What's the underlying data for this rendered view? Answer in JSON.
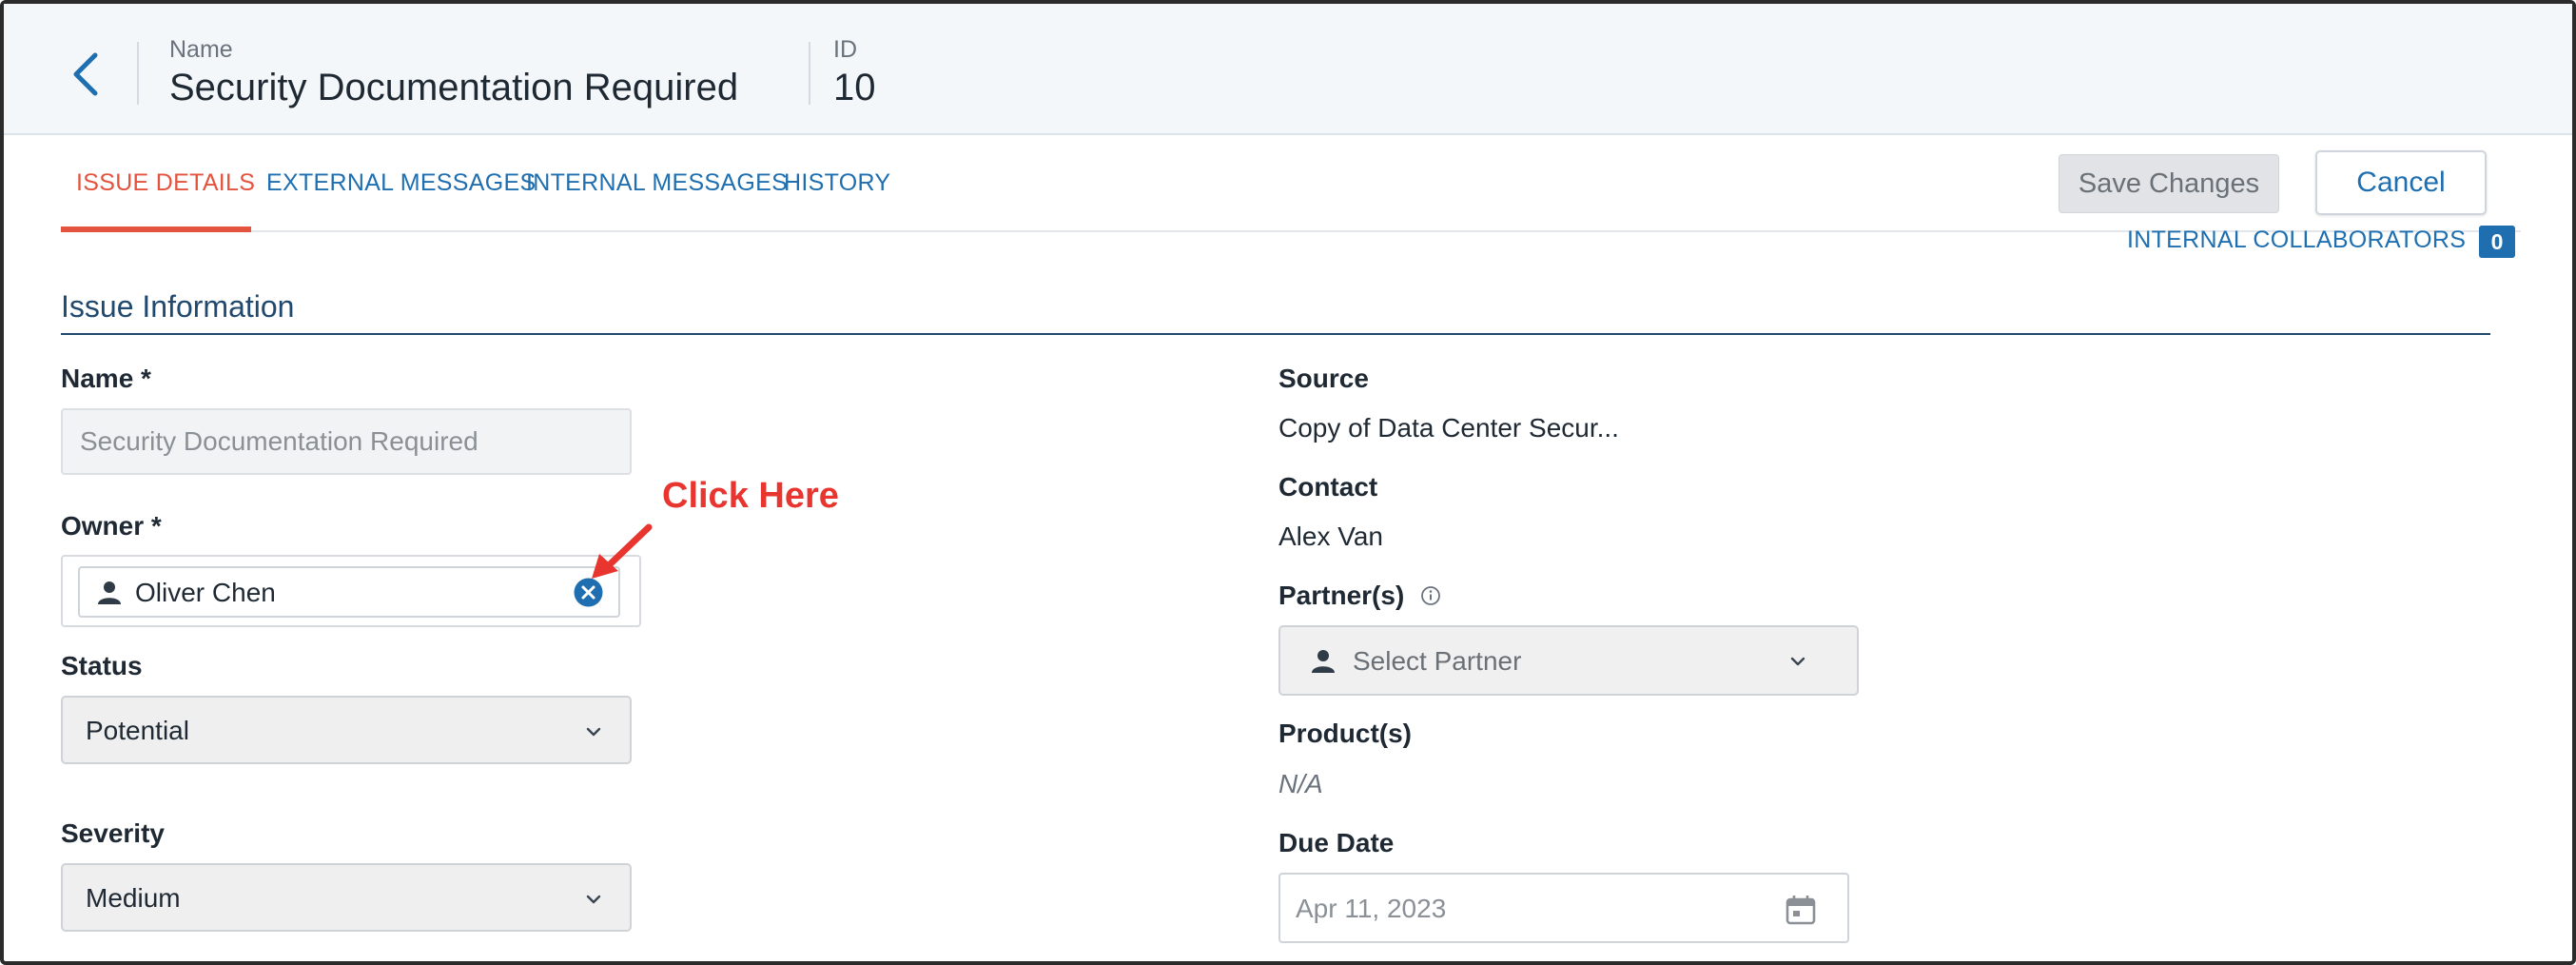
{
  "header": {
    "name_label": "Name",
    "name_value": "Security Documentation Required",
    "id_label": "ID",
    "id_value": "10"
  },
  "tabs": [
    {
      "label": "ISSUE DETAILS",
      "active": true
    },
    {
      "label": "EXTERNAL MESSAGES",
      "active": false
    },
    {
      "label": "INTERNAL MESSAGES",
      "active": false
    },
    {
      "label": "HISTORY",
      "active": false
    }
  ],
  "actions": {
    "save_label": "Save Changes",
    "cancel_label": "Cancel"
  },
  "collaborators": {
    "label": "INTERNAL COLLABORATORS",
    "count": "0"
  },
  "section": {
    "title": "Issue Information"
  },
  "left": {
    "name_label": "Name *",
    "name_value": "Security Documentation Required",
    "owner_label": "Owner *",
    "owner_value": "Oliver Chen",
    "status_label": "Status",
    "status_value": "Potential",
    "severity_label": "Severity",
    "severity_value": "Medium"
  },
  "right": {
    "source_label": "Source",
    "source_value": "Copy of Data Center Secur...",
    "contact_label": "Contact",
    "contact_value": "Alex Van",
    "partners_label": "Partner(s)",
    "partners_placeholder": "Select Partner",
    "products_label": "Product(s)",
    "products_value": "N/A",
    "due_label": "Due Date",
    "due_placeholder": "Apr 11, 2023"
  },
  "annotation": {
    "text": "Click Here",
    "color": "#e8352f"
  },
  "colors": {
    "accent": "#1f6fb0",
    "active_tab": "#e4533d",
    "section": "#21496e"
  },
  "icons": [
    "chevron-left-icon",
    "user-icon",
    "clear-circle-icon",
    "chevron-down-icon",
    "info-icon",
    "calendar-icon"
  ]
}
